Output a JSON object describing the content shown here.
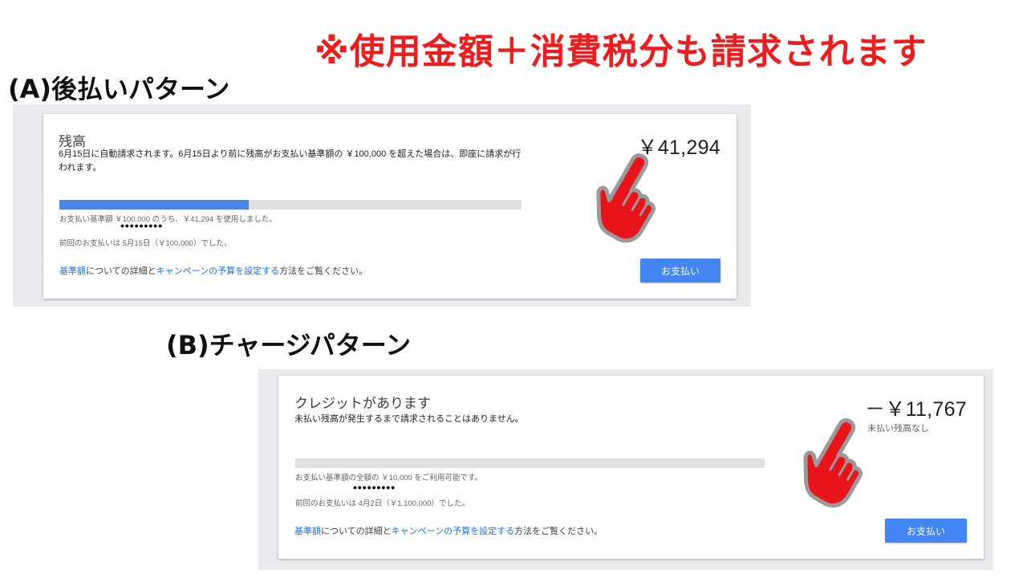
{
  "notice": "※使用金額＋消費税分も請求されます",
  "pattern_a": {
    "label": "(A)後払いパターン",
    "title": "残高",
    "desc_line1": "6月15日に自動請求されます。6月15日より前に残高がお支払い基準額の ￥100,000 を超えた場合は、即座に請求が行",
    "desc_line2": "われます。",
    "amount": "￥41,294",
    "progress_fraction": 0.41,
    "usage_text": "お支払い基準額 ￥100,000 のうち、￥41,294 を使用しました。",
    "dots": "•••••••••",
    "last_payment": "前回のお支払いは 5月15日（￥100,000）でした。",
    "footer": {
      "link1": "基準額",
      "text1": "についての詳細と",
      "link2": "キャンペーンの予算を設定する",
      "text2": "方法をご覧ください。"
    },
    "pay_button": "お支払い"
  },
  "pattern_b": {
    "label": "(B)チャージパターン",
    "title": "クレジットがあります",
    "desc": "未払い残高が発生するまで請求されることはありません。",
    "amount": "－￥11,767",
    "amount_sub": "未払い残高なし",
    "progress_fraction": 0.0,
    "usage_text": "お支払い基準額の全額の ￥10,000 をご利用可能です。",
    "dots": "•••••••••",
    "last_payment": "前回のお支払いは 4月2日（￥1,100,000）でした。",
    "footer": {
      "link1": "基準額",
      "text1": "についての詳細と",
      "link2": "キャンペーンの予算を設定する",
      "text2": "方法をご覧ください。"
    },
    "pay_button": "お支払い"
  },
  "colors": {
    "notice": "#ee1c1c",
    "progress": "#4a86e8",
    "button": "#4285f4",
    "link": "#1a73e8",
    "hand": "#e8141a"
  },
  "icons": [
    "pointing-hand-icon"
  ]
}
